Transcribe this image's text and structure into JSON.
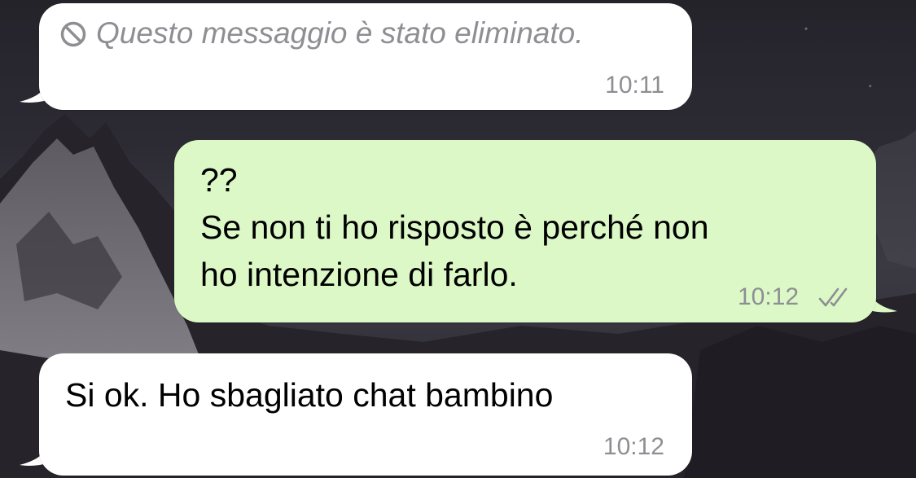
{
  "messages": [
    {
      "type": "deleted",
      "direction": "incoming",
      "text": "Questo messaggio è stato eliminato.",
      "time": "10:11",
      "icon": "prohibited-icon"
    },
    {
      "direction": "outgoing",
      "lines": [
        "??",
        "Se non ti ho risposto è perché non",
        "ho intenzione di farlo."
      ],
      "time": "10:12",
      "status": "read",
      "status_icon": "double-check-icon"
    },
    {
      "direction": "incoming",
      "text": "Si ok. Ho sbagliato chat  bambino",
      "time": "10:12"
    }
  ],
  "colors": {
    "incoming_bubble": "#ffffff",
    "outgoing_bubble": "#dcf8c6",
    "time_text": "#8e8e93"
  }
}
